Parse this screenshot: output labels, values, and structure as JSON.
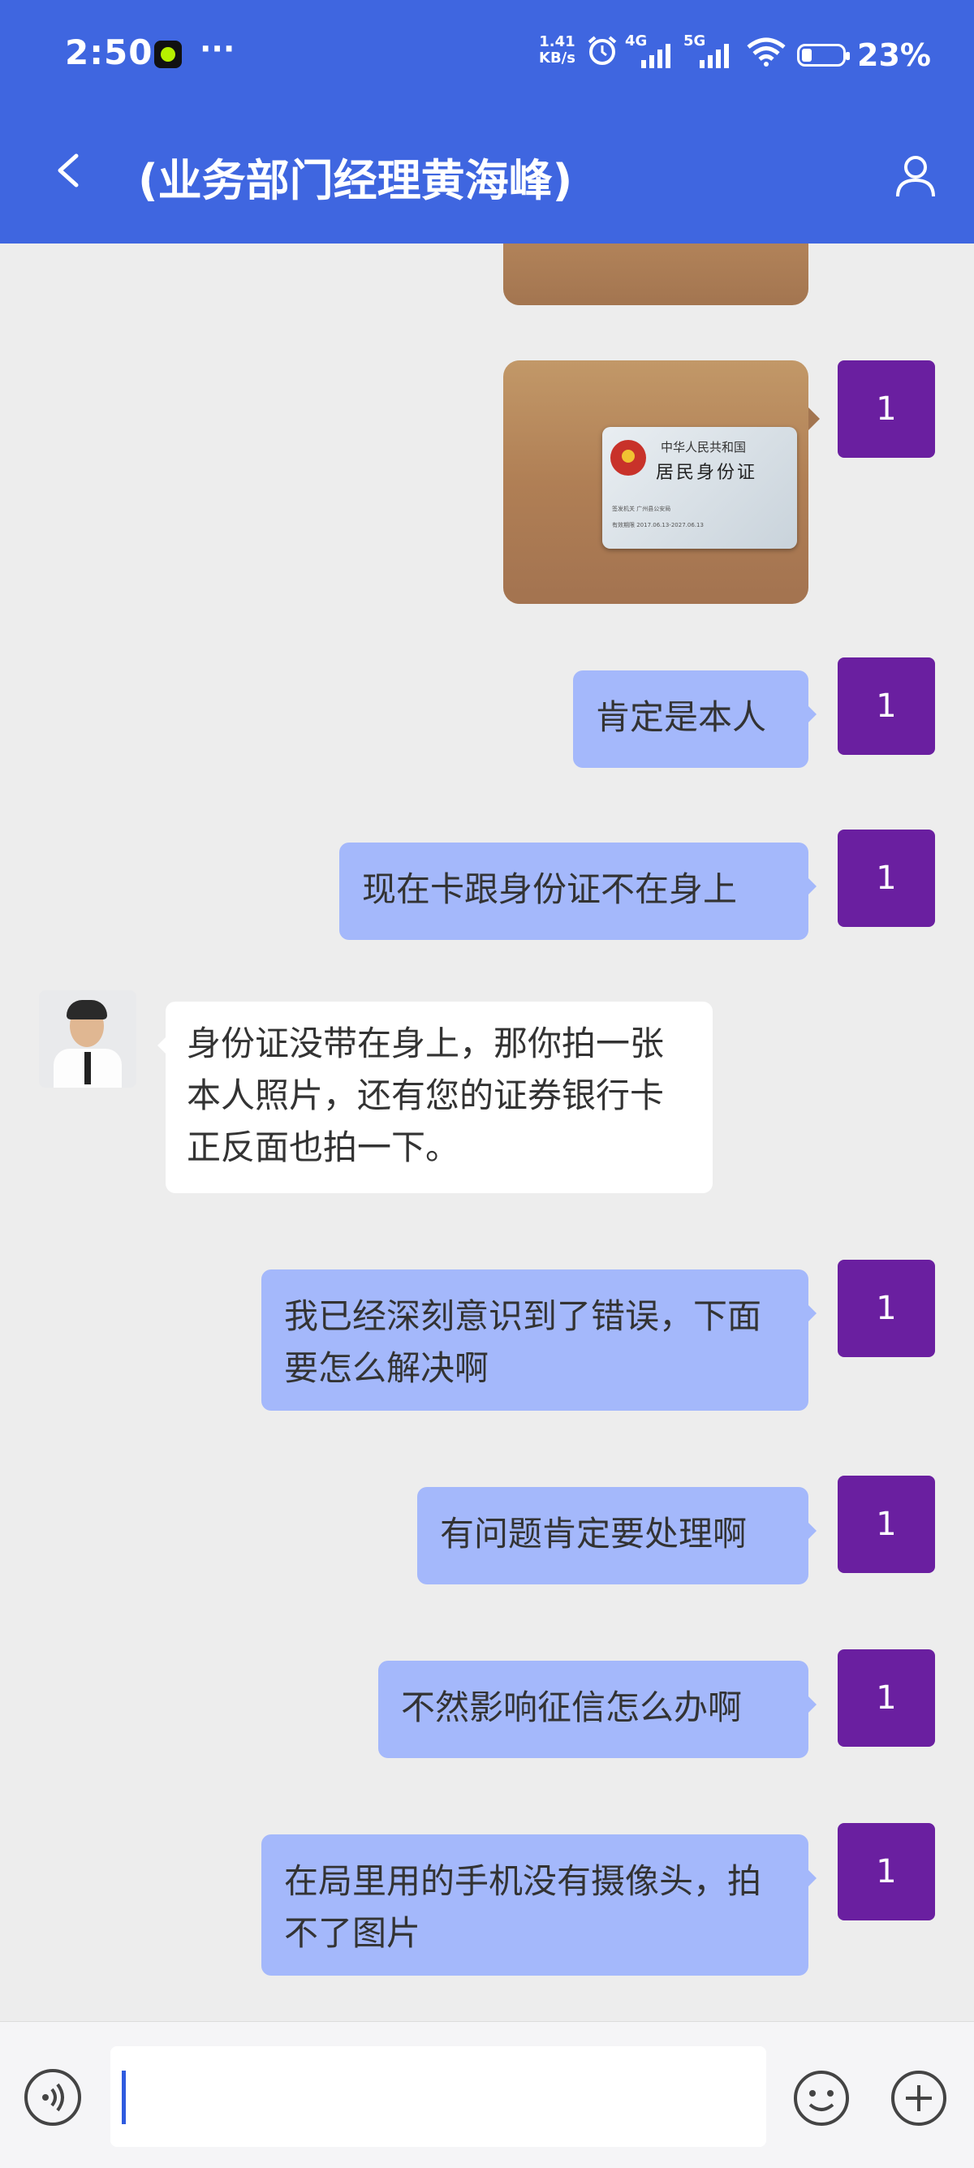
{
  "status_bar": {
    "time": "2:50",
    "more": "···",
    "net_speed": "1.41",
    "net_unit": "KB/s",
    "signal_4g": "4G",
    "signal_5g": "5G",
    "battery": "23%"
  },
  "header": {
    "title": "(业务部门经理黄海峰)",
    "back_icon": "chevron-left-icon",
    "profile_icon": "person-icon"
  },
  "id_card": {
    "line1": "中华人民共和国",
    "line2": "居民身份证",
    "issuer": "签发机关  广州县公安局",
    "validity": "有效期限  2017.06.13-2027.06.13"
  },
  "messages": [
    {
      "side": "out",
      "avatar_text": "1",
      "text": "肯定是本人"
    },
    {
      "side": "out",
      "avatar_text": "1",
      "text": "现在卡跟身份证不在身上"
    },
    {
      "side": "in",
      "text": "身份证没带在身上，那你拍一张本人照片，还有您的证券银行卡正反面也拍一下。"
    },
    {
      "side": "out",
      "avatar_text": "1",
      "text": "我已经深刻意识到了错误，下面要怎么解决啊"
    },
    {
      "side": "out",
      "avatar_text": "1",
      "text": "有问题肯定要处理啊"
    },
    {
      "side": "out",
      "avatar_text": "1",
      "text": "不然影响征信怎么办啊"
    },
    {
      "side": "out",
      "avatar_text": "1",
      "text": "在局里用的手机没有摄像头，拍不了图片"
    }
  ],
  "image_message_avatar_text": "1",
  "input_bar": {
    "value": "",
    "voice_icon": "voice-icon",
    "emoji_icon": "emoji-icon",
    "add_icon": "plus-icon"
  },
  "colors": {
    "header_bg": "#3f66e0",
    "outgoing_bubble": "#a4b8fb",
    "my_avatar": "#6a1fa0",
    "chat_bg": "#ededed"
  }
}
